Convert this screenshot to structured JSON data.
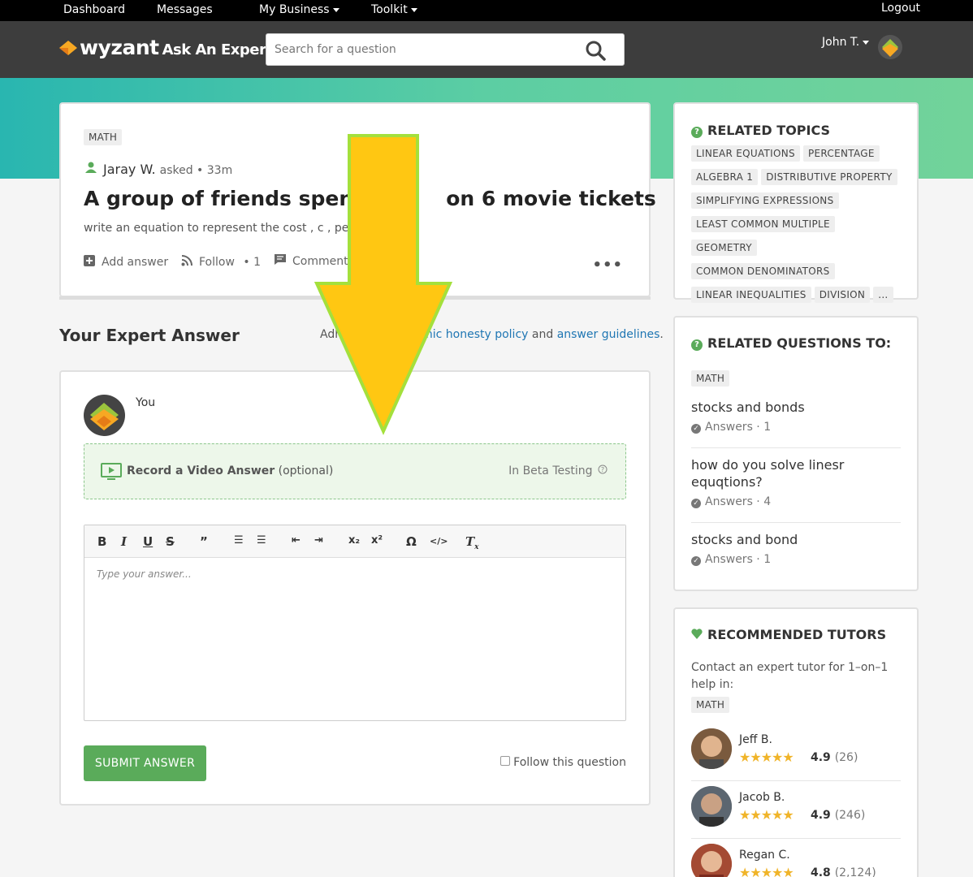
{
  "topnav": {
    "dashboard": "Dashboard",
    "messages": "Messages",
    "my_business": "My Business",
    "toolkit": "Toolkit",
    "logout": "Logout"
  },
  "header": {
    "logo_text": "wyzant",
    "logo_sub": "Ask An Expert",
    "search_placeholder": "Search for a question",
    "user_name": "John T."
  },
  "question": {
    "subject_tag": "MATH",
    "author": "Jaray W.",
    "meta": "asked • 33m",
    "title": "A group of friends spent $",
    "title_rest": "on 6 movie tickets",
    "body": "write an equation to represent the cost , c , per mo",
    "actions": {
      "add_answer": "Add answer",
      "follow": "Follow",
      "follow_count": "• 1",
      "comment": "Comment"
    }
  },
  "answer_section": {
    "heading": "Your Expert Answer",
    "policy_prefix": "Adh",
    "policy_link1": "mic honesty policy",
    "policy_and": "and",
    "policy_link2": "answer guidelines",
    "policy_end": ".",
    "you_label": "You",
    "video_label": "Record a Video Answer",
    "video_optional": "(optional)",
    "beta": "In Beta Testing",
    "editor_placeholder": "Type your answer...",
    "submit": "SUBMIT ANSWER",
    "follow_question": "Follow this question"
  },
  "related_topics": {
    "heading": "RELATED TOPICS",
    "tags": [
      "LINEAR EQUATIONS",
      "PERCENTAGE",
      "ALGEBRA 1",
      "DISTRIBUTIVE PROPERTY",
      "SIMPLIFYING EXPRESSIONS",
      "LEAST COMMON MULTIPLE",
      "GEOMETRY",
      "COMMON DENOMINATORS",
      "LINEAR INEQUALITIES",
      "DIVISION",
      "..."
    ]
  },
  "related_questions": {
    "heading": "RELATED QUESTIONS TO:",
    "tag": "MATH",
    "items": [
      {
        "title": "stocks and bonds",
        "meta": "Answers · 1"
      },
      {
        "title": "how do you solve linesr equqtions?",
        "meta": "Answers · 4"
      },
      {
        "title": "stocks and bond",
        "meta": "Answers · 1"
      }
    ]
  },
  "recommended": {
    "heading": "RECOMMENDED TUTORS",
    "text": "Contact an expert tutor for 1–on–1 help in:",
    "tag": "MATH",
    "tutors": [
      {
        "name": "Jeff B.",
        "rating": "4.9",
        "count": "(26)"
      },
      {
        "name": "Jacob B.",
        "rating": "4.9",
        "count": "(246)"
      },
      {
        "name": "Regan C.",
        "rating": "4.8",
        "count": "(2,124)"
      }
    ]
  },
  "colors": {
    "brand_green": "#5aab5a",
    "link_blue": "#1f76b3",
    "arrow_yellow": "#ffc712",
    "arrow_outline": "#a4e03c"
  }
}
